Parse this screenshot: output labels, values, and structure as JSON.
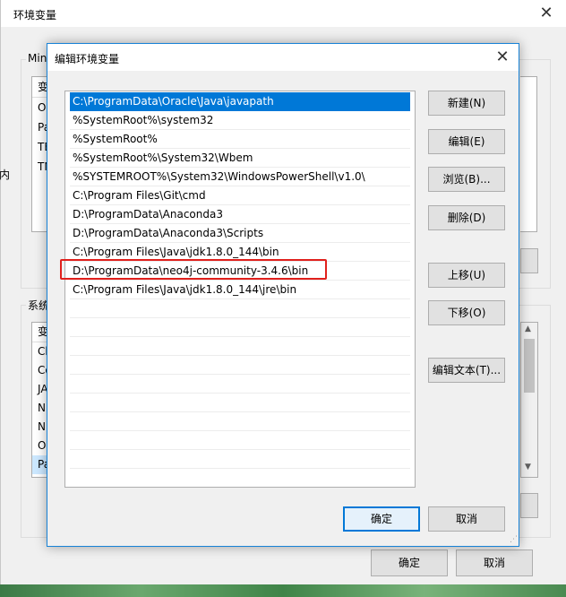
{
  "parent": {
    "title": "环境变量",
    "user_group_label": "Min",
    "user_list_header": "变",
    "user_list_items": [
      "O",
      "Pa",
      "TE",
      "TN"
    ],
    "system_group_label": "系统",
    "system_list_header": "变",
    "system_list_items": [
      "Cl",
      "Co",
      "JA",
      "N",
      "N",
      "O",
      "Pa"
    ],
    "ok_label": "确定",
    "cancel_label": "取消",
    "side_fragment": "内"
  },
  "dialog": {
    "title": "编辑环境变量",
    "paths": [
      "C:\\ProgramData\\Oracle\\Java\\javapath",
      "%SystemRoot%\\system32",
      "%SystemRoot%",
      "%SystemRoot%\\System32\\Wbem",
      "%SYSTEMROOT%\\System32\\WindowsPowerShell\\v1.0\\",
      "C:\\Program Files\\Git\\cmd",
      "D:\\ProgramData\\Anaconda3",
      "D:\\ProgramData\\Anaconda3\\Scripts",
      "C:\\Program Files\\Java\\jdk1.8.0_144\\bin",
      "D:\\ProgramData\\neo4j-community-3.4.6\\bin",
      "C:\\Program Files\\Java\\jdk1.8.0_144\\jre\\bin"
    ],
    "selected_index": 0,
    "highlighted_index": 9,
    "buttons": {
      "new": "新建(N)",
      "edit": "编辑(E)",
      "browse": "浏览(B)...",
      "delete": "删除(D)",
      "move_up": "上移(U)",
      "move_down": "下移(O)",
      "edit_text": "编辑文本(T)..."
    },
    "ok_label": "确定",
    "cancel_label": "取消"
  },
  "colors": {
    "selection": "#0078d7",
    "highlight_box": "#e0201c",
    "dialog_border": "#1883d7"
  }
}
